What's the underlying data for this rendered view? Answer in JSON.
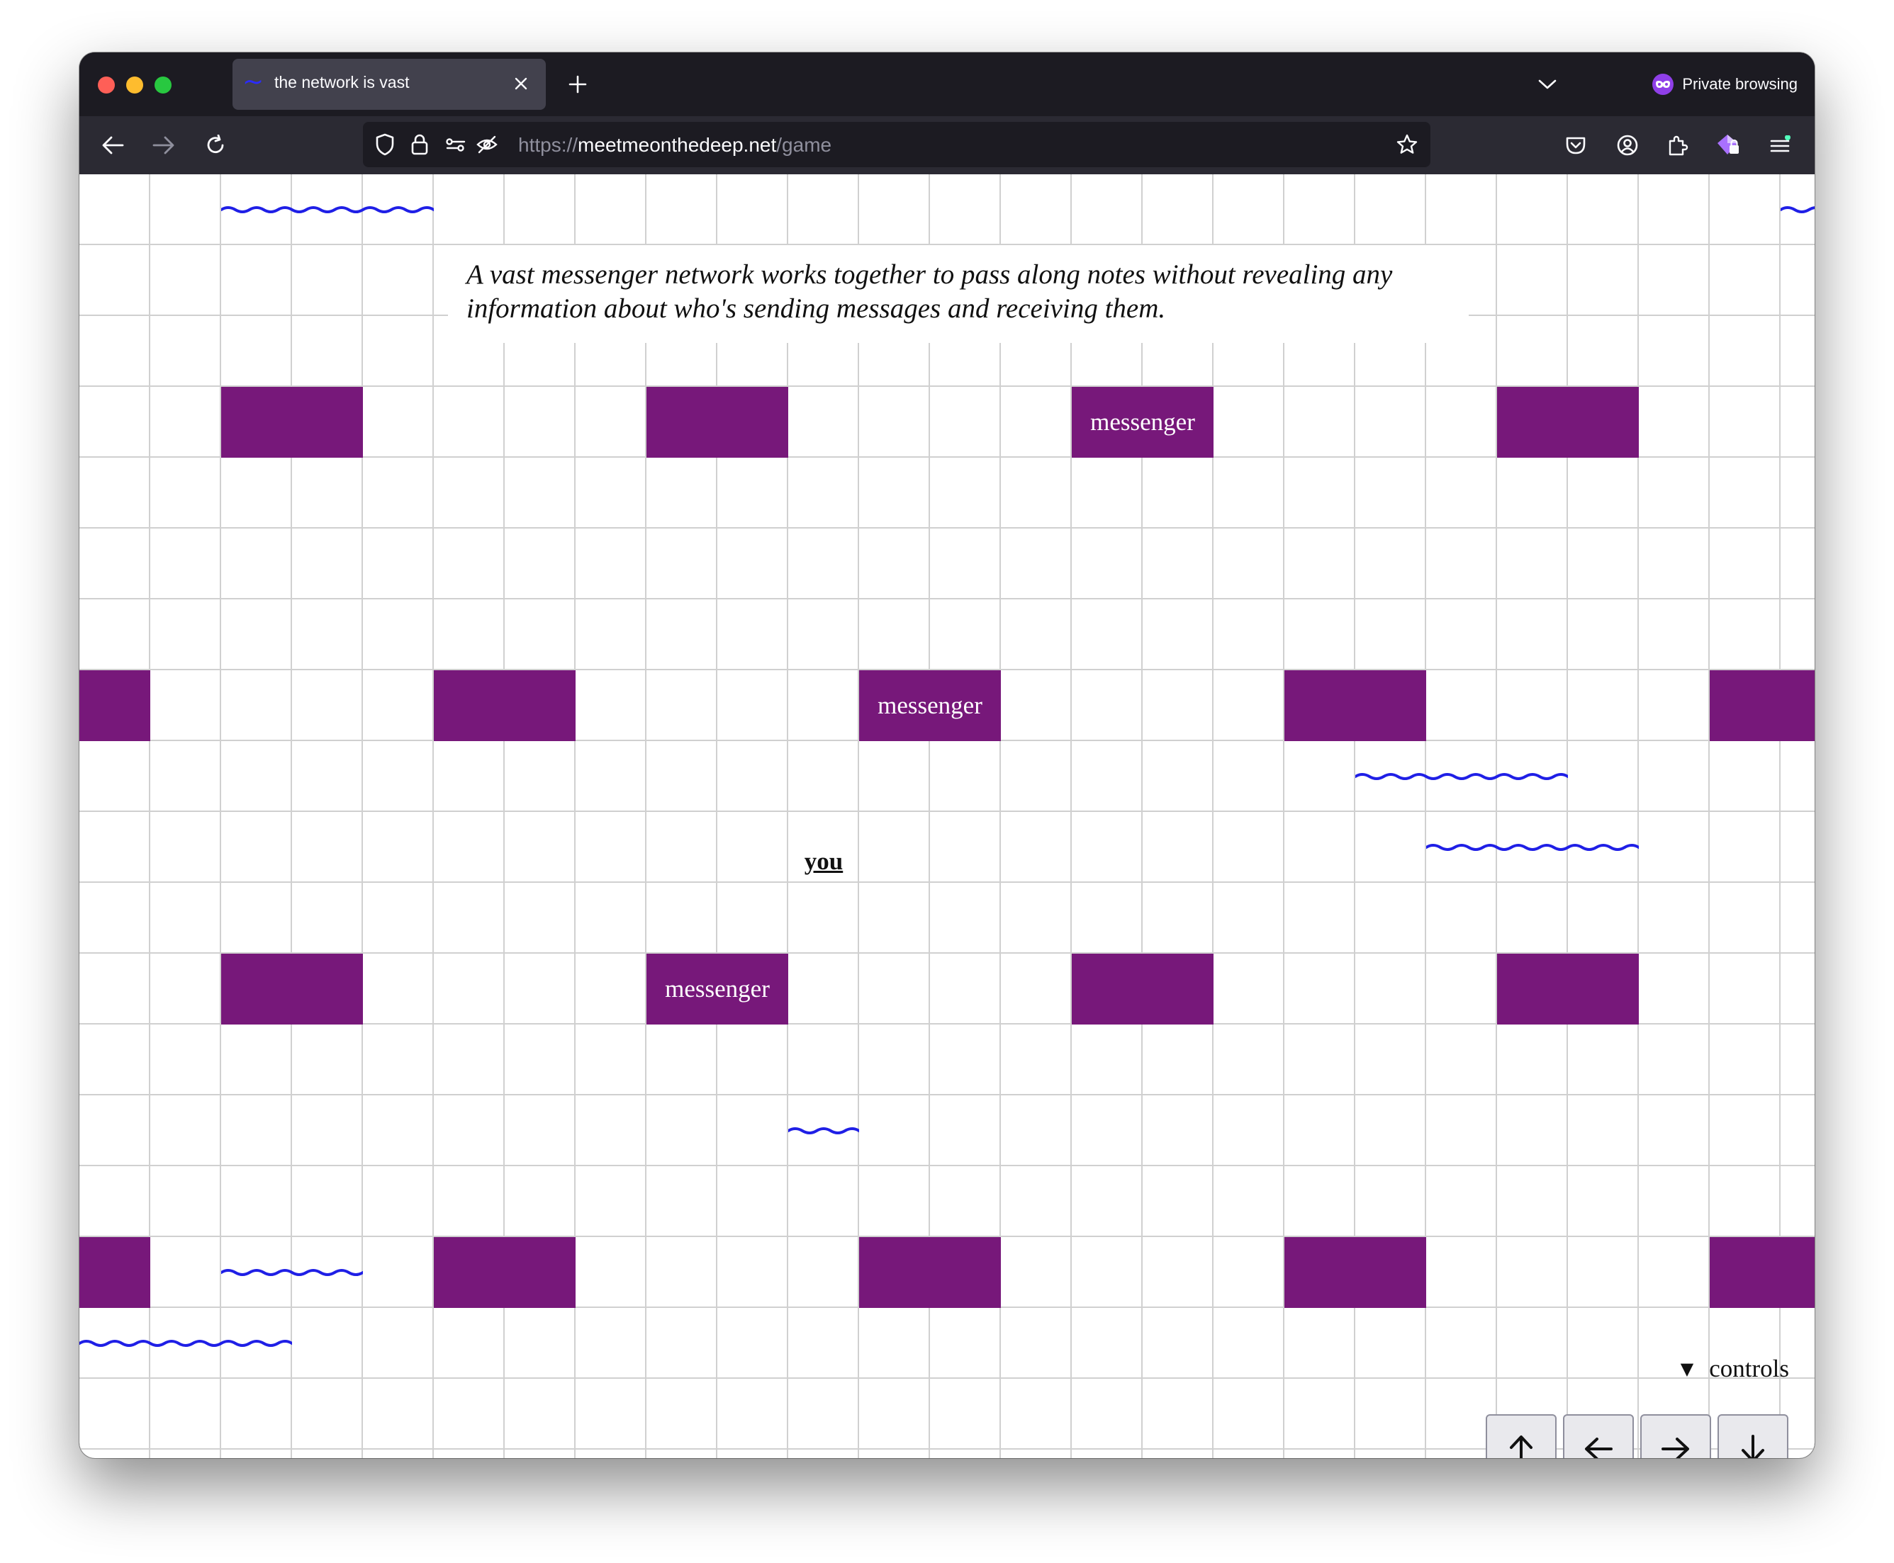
{
  "browser": {
    "tab": {
      "favicon": "~",
      "title": "the network is vast",
      "close_icon": "close-icon"
    },
    "private_label": "Private browsing",
    "url": {
      "scheme": "https://",
      "host": "meetmeonthedeep.net",
      "path": "/game"
    },
    "colors": {
      "chrome": "#1c1b22",
      "toolbar": "#2b2a33",
      "tab_active": "#42414d",
      "private_accent": "#8f3fe8"
    }
  },
  "game": {
    "intro": "A vast messenger network works together to pass along notes without revealing any information about who's sending messages and receiving them.",
    "messenger_label": "messenger",
    "player_label": "you",
    "controls_label": "controls",
    "controls": {
      "up": "↑",
      "left": "←",
      "right": "→",
      "down": "↓"
    },
    "colors": {
      "messenger": "#77187a",
      "message_wave": "#1f1fe6",
      "grid": "#d0d0d0"
    }
  }
}
